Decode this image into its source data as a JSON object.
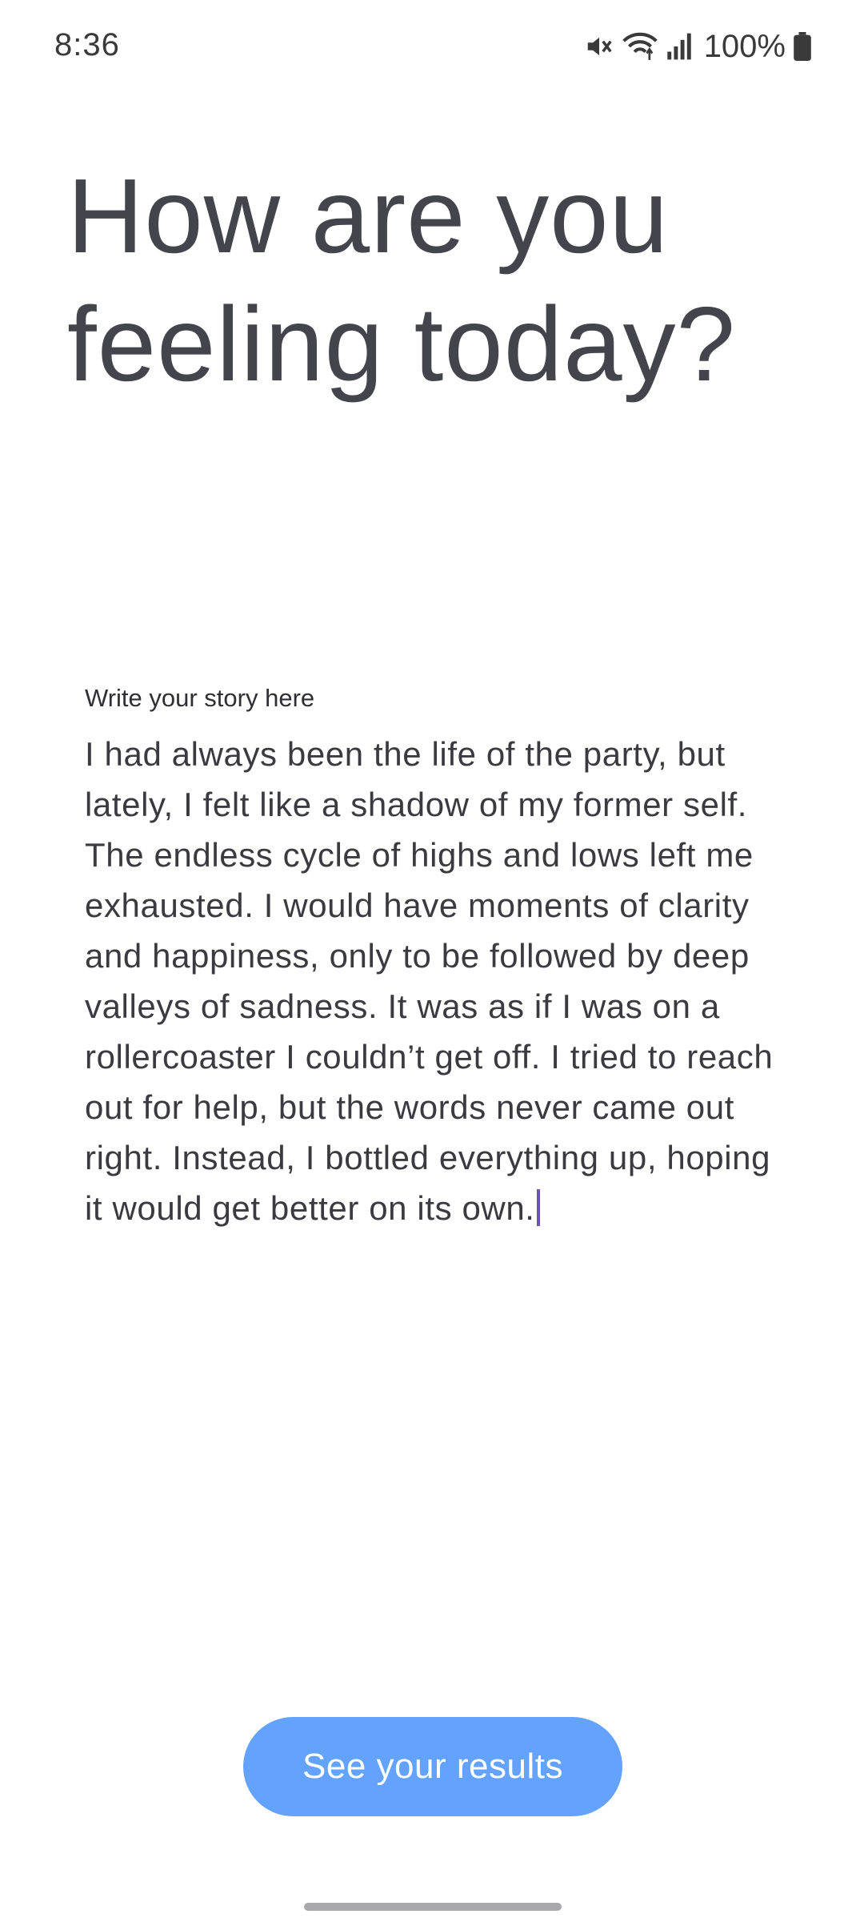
{
  "status_bar": {
    "time": "8:36",
    "battery": "100%",
    "icons": [
      "mute-icon",
      "wifi-icon",
      "signal-icon",
      "battery-icon"
    ]
  },
  "main": {
    "title": "How are you feeling today?",
    "story_label": "Write your story here",
    "story_text": "I had always been the life of the party, but lately, I felt like a shadow of my former self. The endless cycle of highs and lows left me exhausted. I would have moments of clarity and happiness, only to be followed by deep valleys of sadness. It was as if I was on a rollercoaster I couldn’t get off. I tried to reach out for help, but the words never came out right. Instead, I bottled everything up, hoping it would get better on its own.",
    "button_label": "See your results"
  },
  "colors": {
    "accent": "#63a3ff",
    "cursor": "#6b55a8",
    "text": "#44444c"
  }
}
